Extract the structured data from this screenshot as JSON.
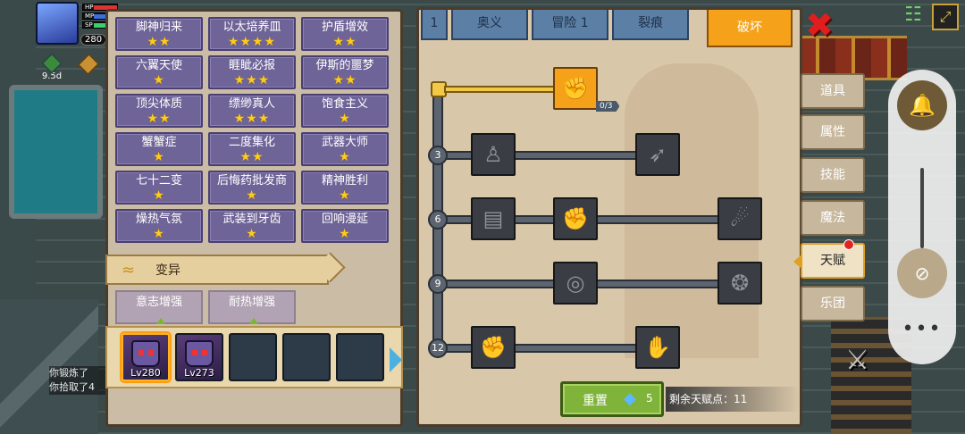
{
  "hud": {
    "hp_label": "HP",
    "mp_label": "MP",
    "sp_label": "SP",
    "level": "280",
    "buff_timer": "9.5d"
  },
  "chat": {
    "line1": "你锻炼了",
    "line2": "你拾取了4"
  },
  "traits": [
    {
      "name": "脚神归来",
      "stars": "★★"
    },
    {
      "name": "以太培养皿",
      "stars": "★★★★"
    },
    {
      "name": "护盾增效",
      "stars": "★★"
    },
    {
      "name": "六翼天使",
      "stars": "★"
    },
    {
      "name": "睚眦必报",
      "stars": "★★★"
    },
    {
      "name": "伊斯的噩梦",
      "stars": "★★"
    },
    {
      "name": "顶尖体质",
      "stars": "★★"
    },
    {
      "name": "缥缈真人",
      "stars": "★★★"
    },
    {
      "name": "饱食主义",
      "stars": "★"
    },
    {
      "name": "蟹蟹症",
      "stars": "★"
    },
    {
      "name": "二度集化",
      "stars": "★★"
    },
    {
      "name": "武器大师",
      "stars": "★"
    },
    {
      "name": "七十二变",
      "stars": "★"
    },
    {
      "name": "后悔药批发商",
      "stars": "★"
    },
    {
      "name": "精神胜利",
      "stars": "★"
    },
    {
      "name": "燥热气氛",
      "stars": "★"
    },
    {
      "name": "武装到牙齿",
      "stars": "★"
    },
    {
      "name": "回响漫延",
      "stars": "★"
    }
  ],
  "mutation_section": {
    "title": "变异",
    "items": [
      {
        "name": "意志增强"
      },
      {
        "name": "耐热增强"
      }
    ]
  },
  "pets": [
    {
      "level": "Lv280",
      "filled": true
    },
    {
      "level": "Lv273",
      "filled": true
    },
    {
      "level": "",
      "filled": false
    },
    {
      "level": "",
      "filled": false
    },
    {
      "level": "",
      "filled": false
    }
  ],
  "tabs": [
    {
      "label": "1"
    },
    {
      "label": "奥义"
    },
    {
      "label": "冒险 1"
    },
    {
      "label": "裂痕"
    },
    {
      "label": "破坏"
    }
  ],
  "tree": {
    "tiers": [
      "3",
      "6",
      "9",
      "12"
    ],
    "root_count": "0/3"
  },
  "reset": {
    "label": "重置",
    "cost": "5",
    "points_label": "剩余天赋点：11"
  },
  "side_tabs": [
    {
      "label": "道具"
    },
    {
      "label": "属性"
    },
    {
      "label": "技能"
    },
    {
      "label": "魔法"
    },
    {
      "label": "天赋"
    },
    {
      "label": "乐团"
    }
  ]
}
